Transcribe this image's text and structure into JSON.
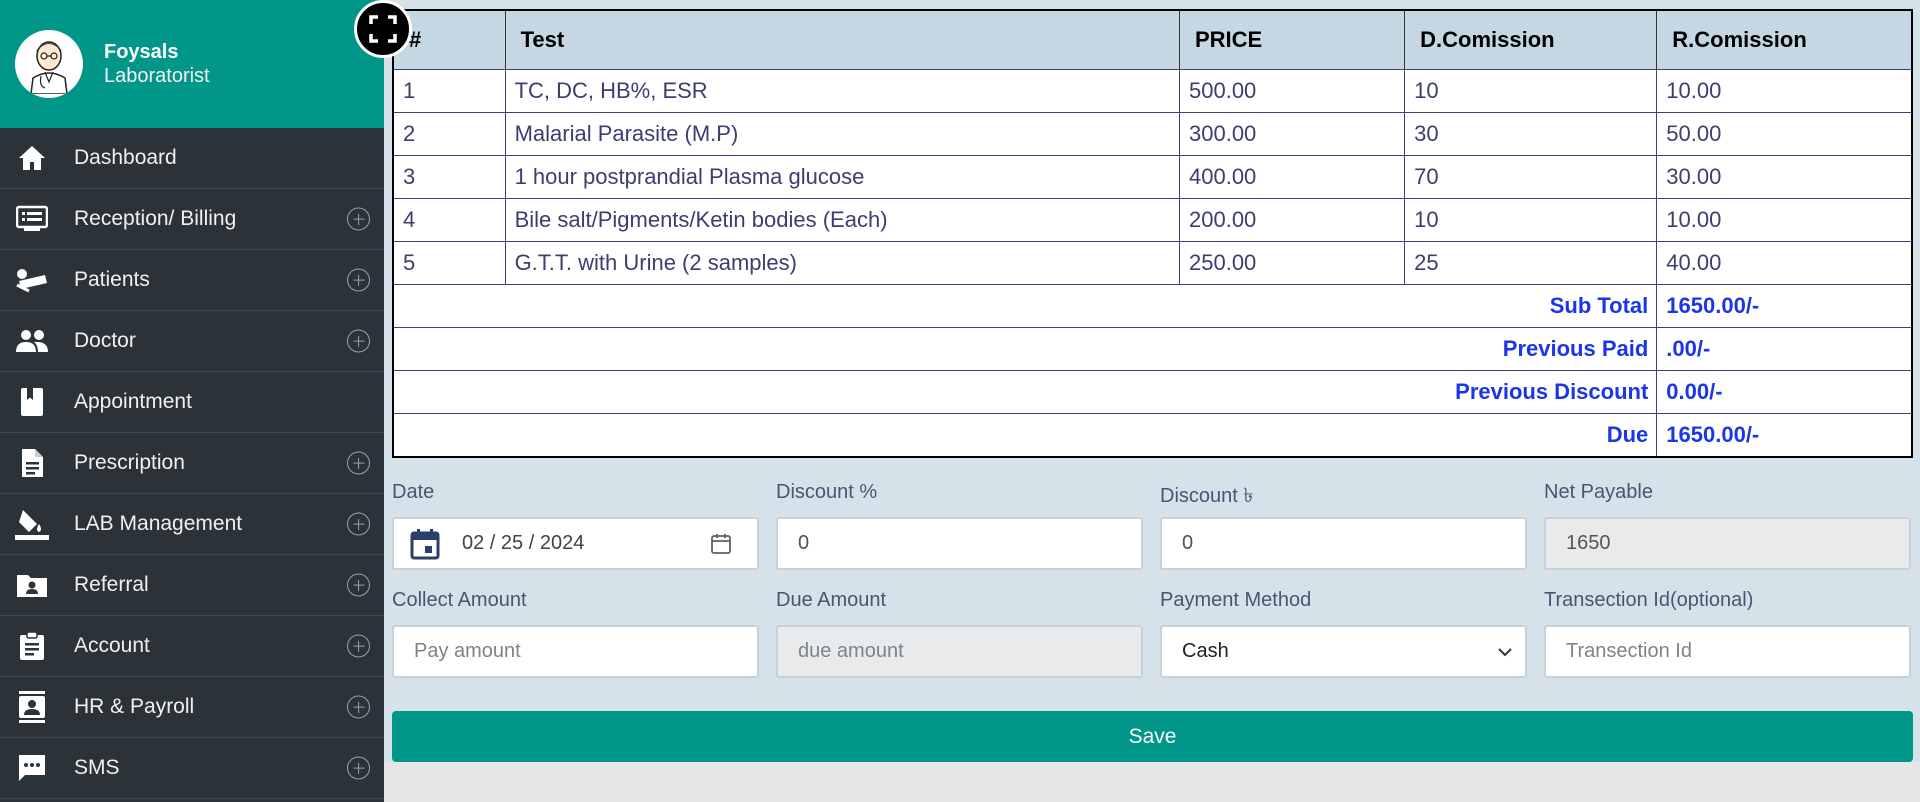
{
  "profile": {
    "name": "Foysals",
    "role": "Laboratorist"
  },
  "menu": [
    {
      "label": "Dashboard",
      "icon": "home-icon",
      "expandable": false
    },
    {
      "label": "Reception/ Billing",
      "icon": "billing-icon",
      "expandable": true
    },
    {
      "label": "Patients",
      "icon": "patient-bed-icon",
      "expandable": true
    },
    {
      "label": "Doctor",
      "icon": "people-icon",
      "expandable": true
    },
    {
      "label": "Appointment",
      "icon": "book-icon",
      "expandable": false
    },
    {
      "label": "Prescription",
      "icon": "document-icon",
      "expandable": true
    },
    {
      "label": "LAB Management",
      "icon": "paint-bucket-icon",
      "expandable": true
    },
    {
      "label": "Referral",
      "icon": "folder-user-icon",
      "expandable": true
    },
    {
      "label": "Account",
      "icon": "clipboard-icon",
      "expandable": true
    },
    {
      "label": "HR & Payroll",
      "icon": "contact-card-icon",
      "expandable": true
    },
    {
      "label": "SMS",
      "icon": "chat-icon",
      "expandable": true
    }
  ],
  "table": {
    "headers": [
      "#",
      "Test",
      "PRICE",
      "D.Comission",
      "R.Comission"
    ],
    "rows": [
      [
        "1",
        "TC, DC, HB%, ESR",
        "500.00",
        "10",
        "10.00"
      ],
      [
        "2",
        "Malarial Parasite (M.P)",
        "300.00",
        "30",
        "50.00"
      ],
      [
        "3",
        "1 hour postprandial Plasma glucose",
        "400.00",
        "70",
        "30.00"
      ],
      [
        "4",
        "Bile salt/Pigments/Ketin bodies (Each)",
        "200.00",
        "10",
        "10.00"
      ],
      [
        "5",
        "G.T.T. with Urine (2 samples)",
        "250.00",
        "25",
        "40.00"
      ]
    ],
    "summary": [
      {
        "label": "Sub Total",
        "value": "1650.00/-"
      },
      {
        "label": "Previous Paid",
        "value": ".00/-"
      },
      {
        "label": "Previous Discount",
        "value": "0.00/-"
      },
      {
        "label": "Due",
        "value": "1650.00/-"
      }
    ]
  },
  "form": {
    "date_label": "Date",
    "date_value": "02 / 25 / 2024",
    "discount_pct_label": "Discount %",
    "discount_pct_value": "0",
    "discount_amt_label": "Discount ৳",
    "discount_amt_value": "0",
    "net_payable_label": "Net Payable",
    "net_payable_value": "1650",
    "collect_label": "Collect Amount",
    "collect_placeholder": "Pay amount",
    "due_label": "Due Amount",
    "due_placeholder": "due amount",
    "payment_label": "Payment Method",
    "payment_value": "Cash",
    "txn_label": "Transection Id(optional)",
    "txn_placeholder": "Transection Id"
  },
  "save_label": "Save",
  "colors": {
    "accent": "#009688",
    "sidebar": "#2b3338",
    "summary_text": "#1b36e8"
  }
}
